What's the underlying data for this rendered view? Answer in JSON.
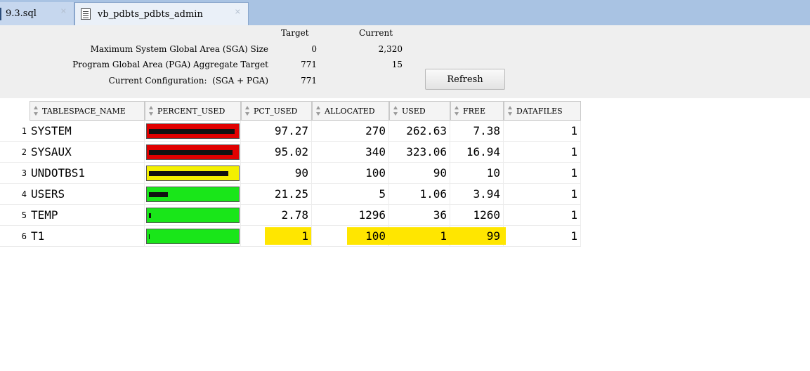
{
  "tabs": [
    {
      "label": "9.3.sql",
      "close": "×"
    },
    {
      "label": "vb_pdbts_pdbts_admin",
      "close": "×"
    }
  ],
  "sga_panel": {
    "col_target": "Target",
    "col_current": "Current",
    "rows": [
      {
        "label": "Maximum System Global Area (SGA) Size",
        "target": "0",
        "current": "2,320"
      },
      {
        "label": "Program Global Area (PGA) Aggregate Target",
        "target": "771",
        "current": "15"
      },
      {
        "label": "Current Configuration:  (SGA + PGA)",
        "target": "771",
        "current": ""
      }
    ],
    "refresh_label": "Refresh"
  },
  "grid": {
    "columns": [
      "TABLESPACE_NAME",
      "PERCENT_USED",
      "PCT_USED",
      "ALLOCATED",
      "USED",
      "FREE",
      "DATAFILES"
    ],
    "rows": [
      {
        "num": "1",
        "name": "SYSTEM",
        "percent_used": 97.27,
        "bar_color": "#e00000",
        "pct_used": "97.27",
        "allocated": "270",
        "used": "262.63",
        "free": "7.38",
        "datafiles": "1"
      },
      {
        "num": "2",
        "name": "SYSAUX",
        "percent_used": 95.02,
        "bar_color": "#e00000",
        "pct_used": "95.02",
        "allocated": "340",
        "used": "323.06",
        "free": "16.94",
        "datafiles": "1"
      },
      {
        "num": "3",
        "name": "UNDOTBS1",
        "percent_used": 90,
        "bar_color": "#f4f000",
        "pct_used": "90",
        "allocated": "100",
        "used": "90",
        "free": "10",
        "datafiles": "1"
      },
      {
        "num": "4",
        "name": "USERS",
        "percent_used": 21.25,
        "bar_color": "#19e619",
        "pct_used": "21.25",
        "allocated": "5",
        "used": "1.06",
        "free": "3.94",
        "datafiles": "1"
      },
      {
        "num": "5",
        "name": "TEMP",
        "percent_used": 2.78,
        "bar_color": "#19e619",
        "pct_used": "2.78",
        "allocated": "1296",
        "used": "36",
        "free": "1260",
        "datafiles": "1"
      },
      {
        "num": "6",
        "name": "T1",
        "percent_used": 1,
        "bar_color": "#19e619",
        "pct_used": "1",
        "allocated": "100",
        "used": "1",
        "free": "99",
        "datafiles": "1",
        "highlighted": true
      }
    ]
  },
  "colors": {
    "highlight": "#ffe600",
    "tabbar": "#a9c3e3"
  }
}
